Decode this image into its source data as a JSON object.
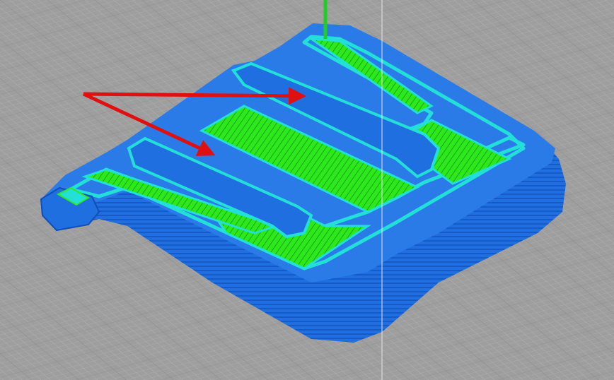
{
  "viewport": {
    "type": "3d-slicer-layer-preview"
  },
  "colors": {
    "background": "#9e9e9e",
    "grid_minor": "#b3b3b3",
    "grid_major": "#8a8a8a",
    "outer_wall": "#1f6fe0",
    "outer_wall_dark": "#0f4fb8",
    "outer_wall_light": "#3a8af0",
    "inner_wall": "#22e0d8",
    "infill": "#2ee81e",
    "infill_line": "#1aa612",
    "travel_move": "#22cc22",
    "annotation_arrow": "#e01010",
    "cursor_line": "#e6e6e6"
  },
  "icons": {
    "arrow_a": "red-arrow-icon",
    "arrow_b": "red-arrow-icon"
  }
}
